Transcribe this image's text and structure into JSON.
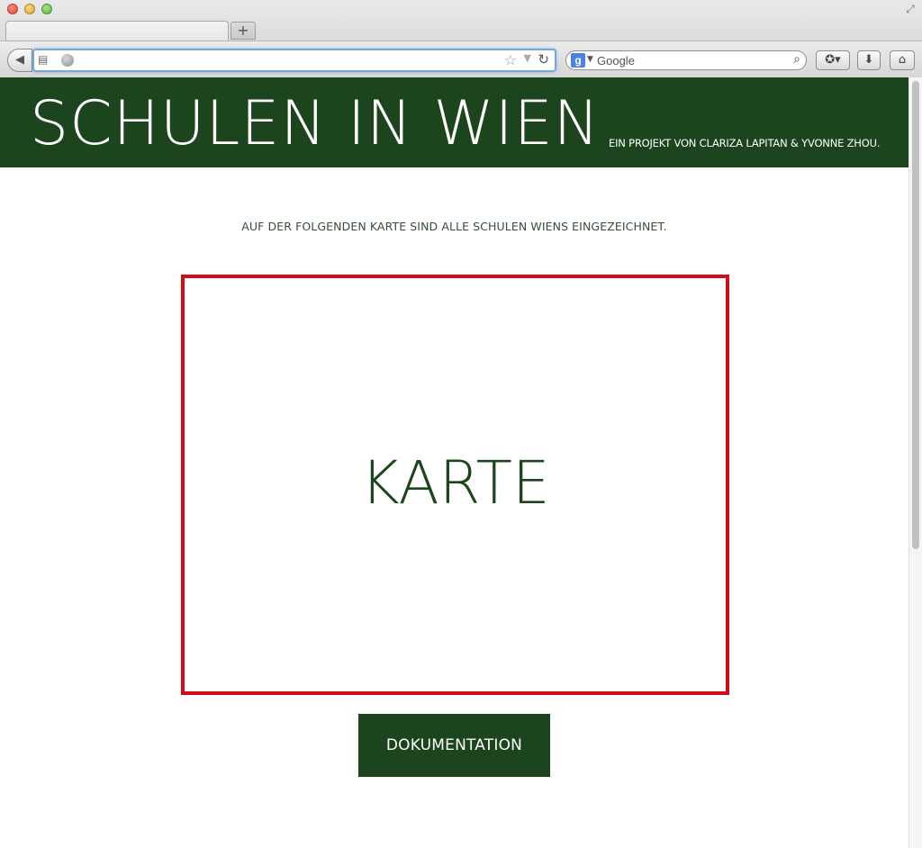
{
  "browser": {
    "tab": {
      "title": ""
    },
    "new_tab_label": "+",
    "address": {
      "value": "",
      "placeholder": ""
    },
    "search": {
      "engine": "Google",
      "placeholder": "Google",
      "value": ""
    },
    "icons": {
      "close": "close-traffic-light",
      "minimize": "minimize-traffic-light",
      "maximize": "zoom-traffic-light",
      "back": "back-arrow-icon",
      "bookmarks": "bookmarks-icon",
      "site": "globe-icon",
      "star": "star-icon",
      "reload": "reload-icon",
      "search": "magnifier-icon",
      "downloads": "download-icon",
      "home": "home-icon"
    }
  },
  "page": {
    "header": {
      "title": "SCHULEN IN WIEN",
      "subtitle": "EIN PROJEKT VON CLARIZA LAPITAN & YVONNE ZHOU."
    },
    "intro": "AUF DER FOLGENDEN KARTE SIND ALLE SCHULEN WIENS EINGEZEICHNET.",
    "map": {
      "label": "KARTE"
    },
    "documentation_button": "DOKUMENTATION"
  },
  "colors": {
    "brand_green": "#1c451d",
    "map_border_red": "#d30b14",
    "page_background": "#ffffff"
  }
}
